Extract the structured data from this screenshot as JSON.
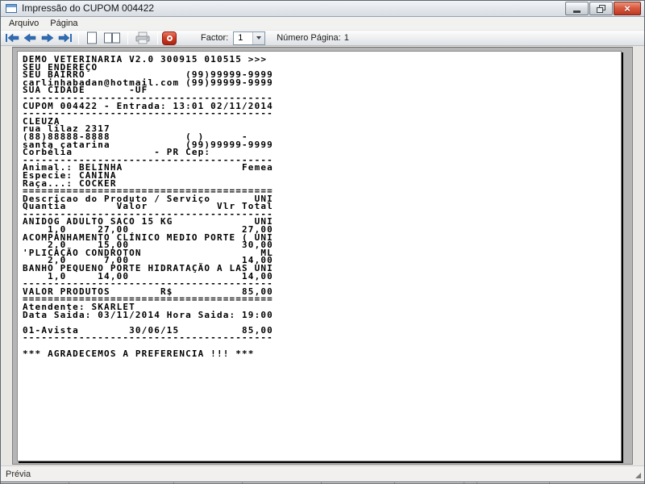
{
  "window": {
    "title": "Impressão do CUPOM 004422"
  },
  "icons": {
    "app": "form-window",
    "minimize": "–",
    "restore": "❐",
    "close": "×",
    "first_page": "⇤",
    "prev_page": "←",
    "next_page": "→",
    "last_page": "⇥",
    "single_page_view": "□",
    "two_page_view": "⧉",
    "print": "printer",
    "stop": "⏻",
    "dropdown_arrow": "▼",
    "resize_grip": "◢"
  },
  "menu": {
    "items": [
      {
        "label": "Arquivo"
      },
      {
        "label": "Página"
      }
    ]
  },
  "toolbar": {
    "factor_label": "Factor:",
    "factor_value": "1",
    "page_number_label": "Número Página:",
    "page_number_value": "1"
  },
  "receipt": {
    "lines": [
      "DEMO VETERINARIA V2.0 300915 010515 >>>",
      "SEU ENDEREÇO",
      "SEU BAIRRO                (99)99999-9999",
      "carlinhabadan@hotmail.com (99)99999-9999",
      "SUA CIDADE       -UF",
      "----------------------------------------",
      "CUPOM 004422 - Entrada: 13:01 02/11/2014",
      "----------------------------------------",
      "CLEUZA",
      "rua lilaz 2317",
      "(88)88888-8888            ( )      -",
      "santa catarina            (99)99999-9999",
      "Corbélia             - PR Cep:",
      "----------------------------------------",
      "Animal.: BELINHA                   Femea",
      "Especie: CANINA",
      "Raça...: COCKER",
      "========================================",
      "Descricao do Produto / Serviço       UNI",
      "Quantia        Valor           Vlr Total",
      "----------------------------------------",
      "ANIDOG ADULTO SACO 15 KG             UNI",
      "    1,0     27,00                  27,00",
      "ACOMPANHAMENTO CLÍNICO MEDIO PORTE ( UNI",
      "    2,0     15,00                  30,00",
      "'PLICAÇÃO CONDROTON                   ML",
      "    2,0      7,00                  14,00",
      "BANHO PEQUENO PORTE HIDRATAÇÃO A LAS UNI",
      "    1,0     14,00                  14,00",
      "----------------------------------------",
      "VALOR PRODUTOS        R$           85,00",
      "========================================",
      "Atendente: SKARLET",
      "Data Saida: 03/11/2014 Hora Saida: 19:00",
      "",
      "01-Avista        30/06/15          85,00",
      "----------------------------------------",
      "",
      "*** AGRADECEMOS A PREFERENCIA !!! ***"
    ]
  },
  "statusbar": {
    "text": "Prévia"
  },
  "colors": {
    "arrow_blue": "#2e6db4",
    "stop_red": "#cf3b24",
    "page_shadow": "#000000",
    "preview_gray": "#b5b5b5"
  }
}
